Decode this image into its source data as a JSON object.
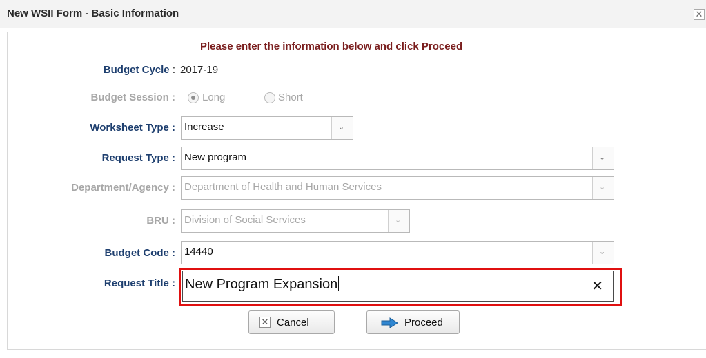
{
  "window": {
    "title": "New WSII Form - Basic Information",
    "close_glyph": "✕"
  },
  "instruction": "Please enter the information below and click Proceed",
  "fields": {
    "budget_cycle": {
      "label": "Budget Cycle",
      "value": "2017-19"
    },
    "budget_session": {
      "label": "Budget Session :",
      "options": [
        "Long",
        "Short"
      ],
      "selected": "Long"
    },
    "worksheet_type": {
      "label": "Worksheet Type :",
      "value": "Increase"
    },
    "request_type": {
      "label": "Request Type :",
      "value": "New program"
    },
    "department": {
      "label": "Department/Agency :",
      "value": "Department of Health and Human Services"
    },
    "bru": {
      "label": "BRU :",
      "value": "Division of Social Services"
    },
    "budget_code": {
      "label": "Budget Code :",
      "value": "14440"
    },
    "request_title": {
      "label": "Request Title :",
      "value": "New Program Expansion",
      "clear_glyph": "✕"
    }
  },
  "buttons": {
    "cancel": "Cancel",
    "proceed": "Proceed"
  },
  "colors": {
    "highlight": "#e01010",
    "label": "#1e3f6f",
    "instruction": "#7a1e1e",
    "arrow": "#2f86d1"
  }
}
